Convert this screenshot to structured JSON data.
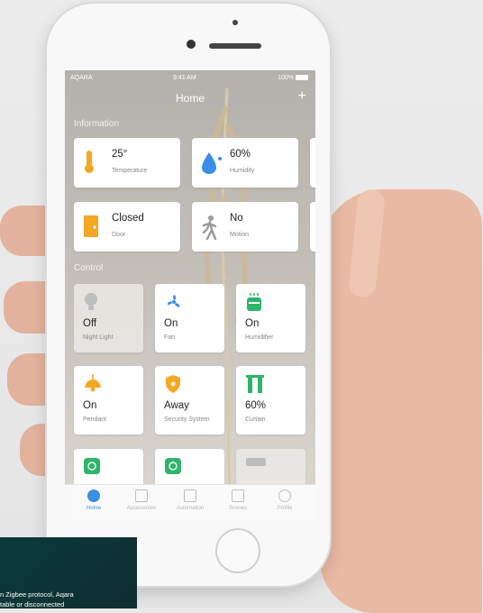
{
  "status_bar": {
    "carrier": "AQARA",
    "time": "9:41 AM",
    "battery": "100%"
  },
  "header": {
    "title": "Home",
    "add_label": "+"
  },
  "sections": {
    "information": "Information",
    "control": "Control"
  },
  "info_cards": [
    {
      "value": "25°",
      "label": "Temperature",
      "icon": "thermometer-icon"
    },
    {
      "value": "60%",
      "label": "Humidity",
      "icon": "water-drop-icon"
    },
    {
      "value": "Closed",
      "label": "Door",
      "icon": "door-icon"
    },
    {
      "value": "No",
      "label": "Motion",
      "icon": "person-walking-icon"
    }
  ],
  "control_cards": [
    {
      "value": "Off",
      "label": "Night Light",
      "icon": "bulb-icon"
    },
    {
      "value": "On",
      "label": "Fan",
      "icon": "fan-icon"
    },
    {
      "value": "On",
      "label": "Humidifier",
      "icon": "humidifier-icon"
    },
    {
      "value": "On",
      "label": "Pendant",
      "icon": "pendant-lamp-icon"
    },
    {
      "value": "Away",
      "label": "Security System",
      "icon": "shield-icon"
    },
    {
      "value": "60%",
      "label": "Curtain",
      "icon": "curtain-icon"
    }
  ],
  "tabs": [
    {
      "label": "Home",
      "icon": "home-icon",
      "active": true
    },
    {
      "label": "Accessories",
      "icon": "accessories-icon"
    },
    {
      "label": "Automation",
      "icon": "automation-icon"
    },
    {
      "label": "Scenes",
      "icon": "scenes-icon"
    },
    {
      "label": "Profile",
      "icon": "profile-icon"
    }
  ],
  "banner": {
    "line1": "n Zigbee protocol, Aqara",
    "line2": "table or disconnected"
  },
  "colors": {
    "accent_blue": "#3a8ee6",
    "accent_orange": "#f5a623",
    "accent_green": "#2fb56a",
    "banner_bg": "#0f2e31"
  }
}
